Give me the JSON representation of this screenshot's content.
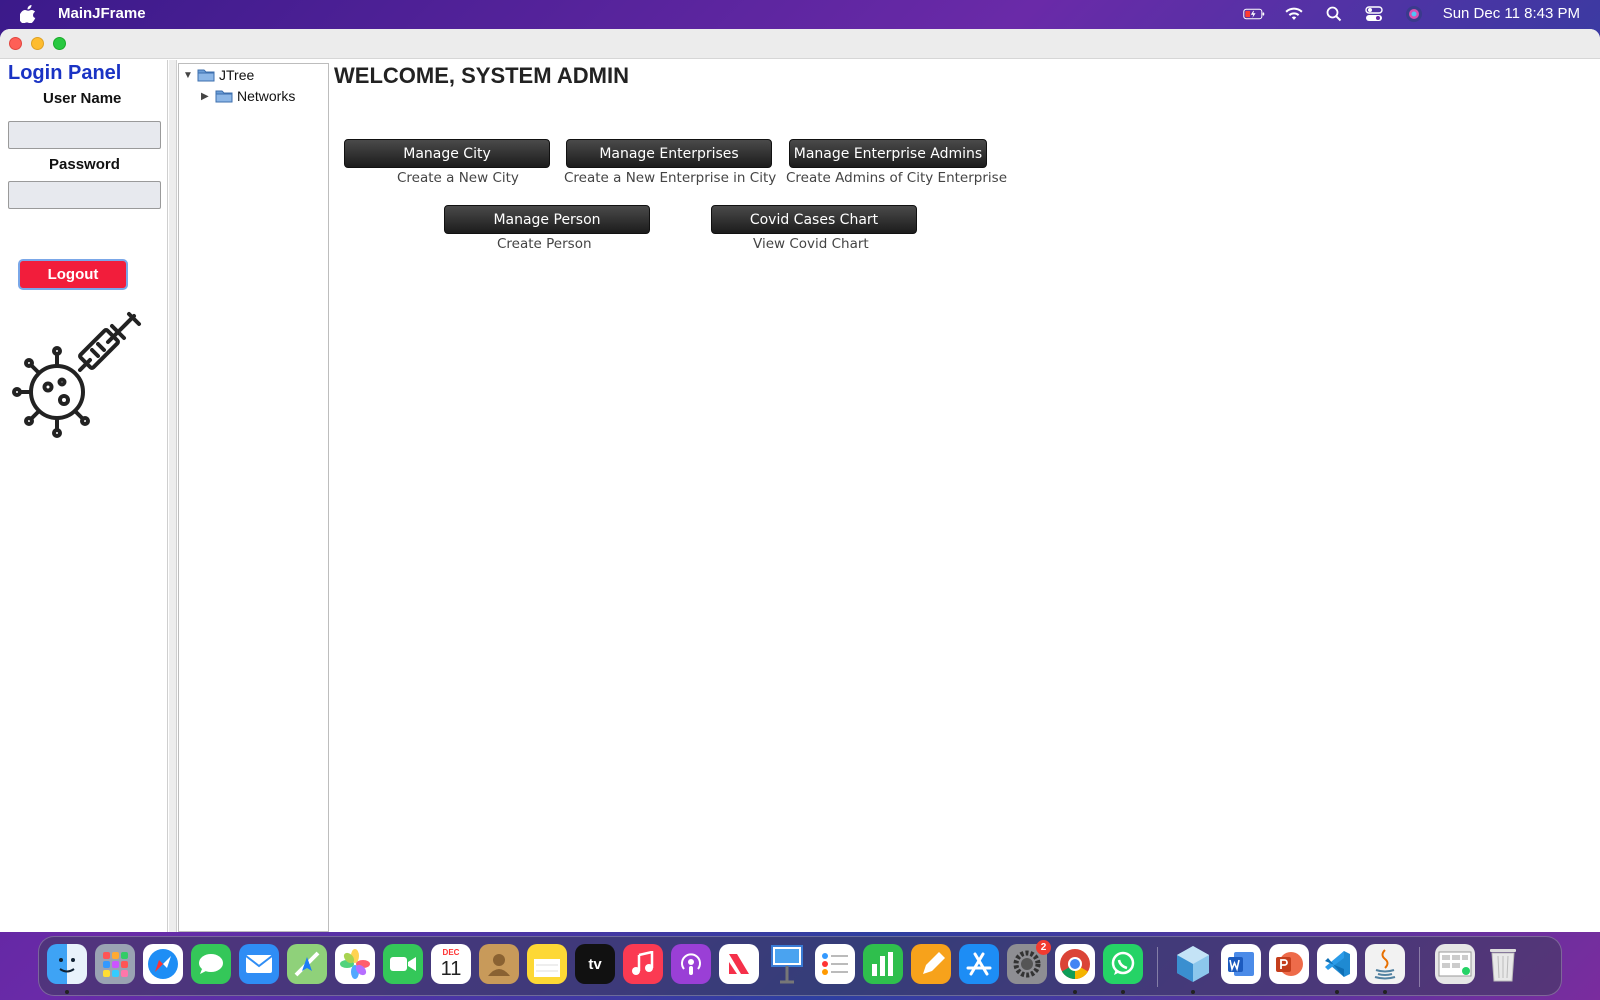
{
  "menubar": {
    "app_name": "MainJFrame",
    "datetime": "Sun Dec 11  8:43 PM"
  },
  "login_panel": {
    "title": "Login Panel",
    "username_label": "User Name",
    "username_value": "",
    "password_label": "Password",
    "password_value": "",
    "logout_label": "Logout"
  },
  "tree": {
    "root_label": "JTree",
    "child_label": "Networks"
  },
  "main": {
    "welcome": "WELCOME, SYSTEM ADMIN",
    "actions": [
      {
        "button": "Manage City",
        "caption": "Create a New City"
      },
      {
        "button": "Manage Enterprises",
        "caption": "Create a New Enterprise in City"
      },
      {
        "button": "Manage Enterprise Admins",
        "caption": "Create Admins of City Enterprise"
      },
      {
        "button": "Manage Person",
        "caption": "Create Person"
      },
      {
        "button": "Covid Cases Chart",
        "caption": "View Covid Chart"
      }
    ]
  },
  "dock": {
    "calendar_month": "DEC",
    "calendar_day": "11",
    "tv_label": "tv",
    "settings_badge": "2",
    "apps": [
      "finder-icon",
      "launchpad-icon",
      "safari-icon",
      "messages-icon",
      "mail-icon",
      "maps-icon",
      "photos-icon",
      "facetime-icon",
      "calendar-icon",
      "contacts-icon",
      "notes-icon",
      "apple-tv-icon",
      "music-icon",
      "podcasts-icon",
      "news-icon",
      "keynote-icon",
      "reminders-icon",
      "numbers-icon",
      "pages-icon",
      "app-store-icon",
      "system-settings-icon",
      "chrome-icon",
      "whatsapp-icon",
      "netbeans-icon",
      "word-icon",
      "powerpoint-icon",
      "vscode-icon",
      "java-icon",
      "preview-icon",
      "trash-icon"
    ]
  }
}
